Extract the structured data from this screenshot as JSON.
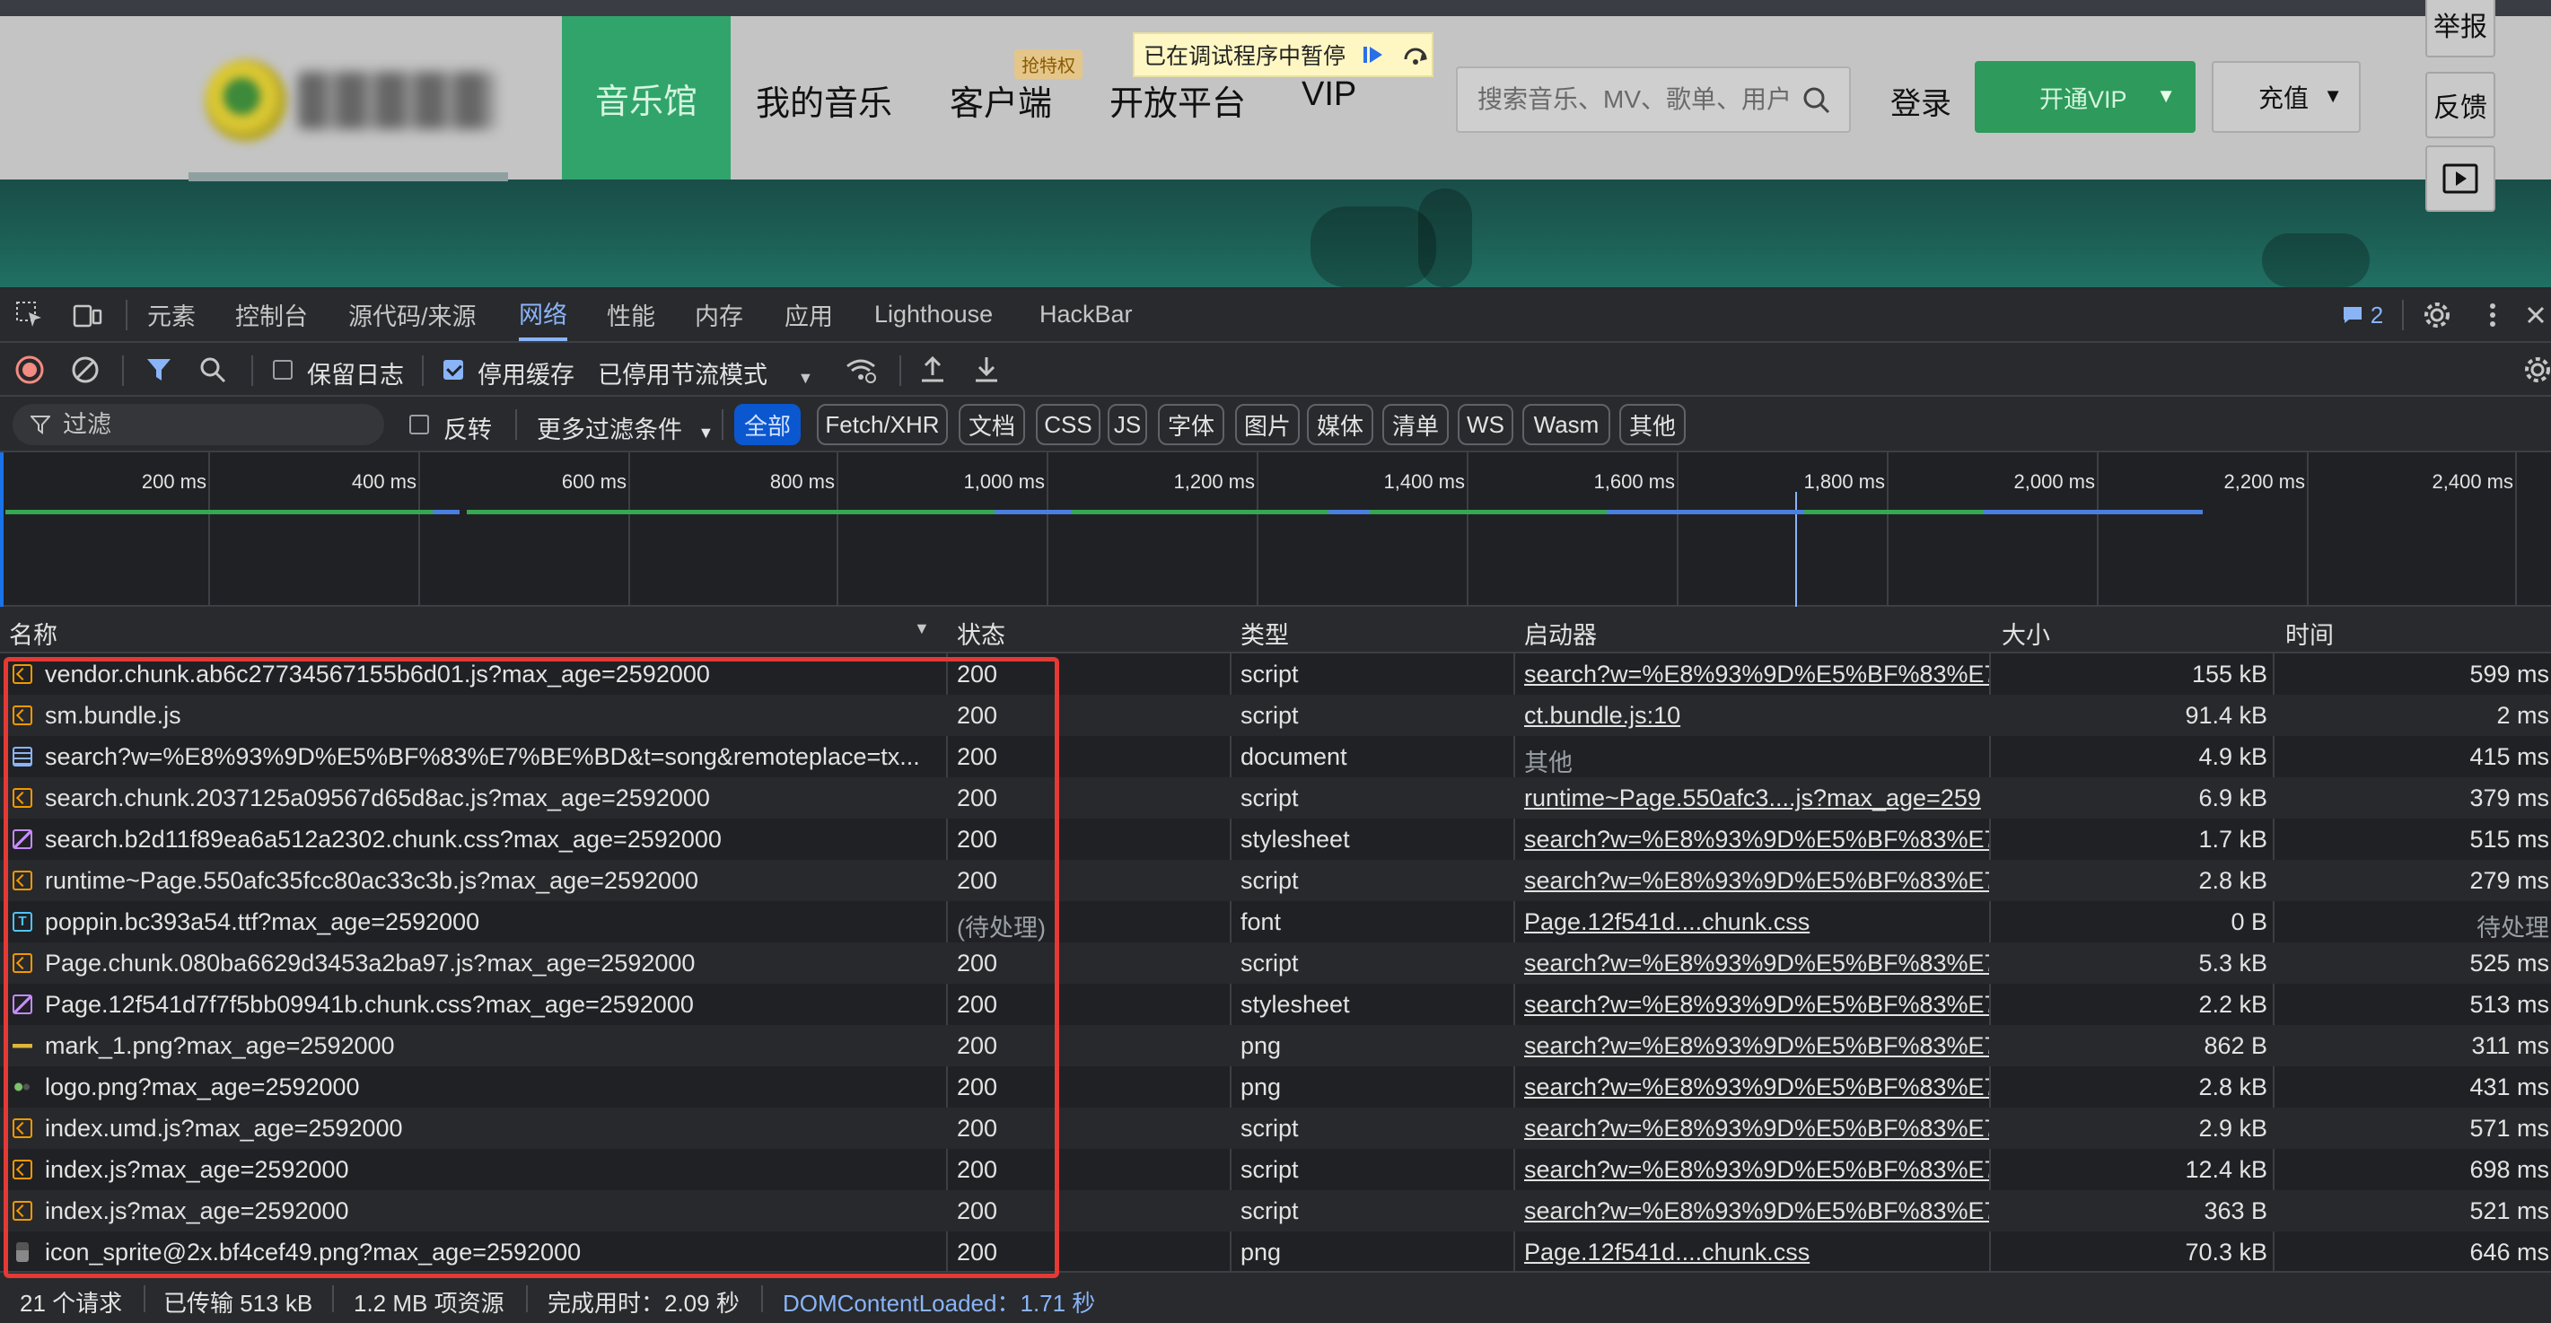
{
  "website": {
    "nav": {
      "music_hall": "音乐馆",
      "my_music": "我的音乐",
      "client": "客户端",
      "client_badge": "抢特权",
      "open_platform": "开放平台",
      "vip": "VIP"
    },
    "debugger_banner": "已在调试程序中暂停",
    "search_placeholder": "搜索音乐、MV、歌单、用户",
    "login": "登录",
    "vip_button": "开通VIP",
    "recharge_button": "充值",
    "side": {
      "report": "举报",
      "feedback": "反馈"
    }
  },
  "devtools": {
    "tabs": [
      "元素",
      "控制台",
      "源代码/来源",
      "网络",
      "性能",
      "内存",
      "应用",
      "Lighthouse",
      "HackBar"
    ],
    "active_tab": "网络",
    "issues_count": "2",
    "toolbar": {
      "preserve_log": "保留日志",
      "disable_cache": "停用缓存",
      "throttling": "已停用节流模式"
    },
    "filter": {
      "placeholder": "过滤",
      "invert": "反转",
      "more_filters": "更多过滤条件",
      "chips": [
        "全部",
        "Fetch/XHR",
        "文档",
        "CSS",
        "JS",
        "字体",
        "图片",
        "媒体",
        "清单",
        "WS",
        "Wasm",
        "其他"
      ]
    },
    "overview_ticks": [
      "200 ms",
      "400 ms",
      "600 ms",
      "800 ms",
      "1,000 ms",
      "1,200 ms",
      "1,400 ms",
      "1,600 ms",
      "1,800 ms",
      "2,000 ms",
      "2,200 ms",
      "2,400 ms"
    ],
    "columns": {
      "name": "名称",
      "status": "状态",
      "type": "类型",
      "initiator": "启动器",
      "size": "大小",
      "time": "时间"
    },
    "rows": [
      {
        "icon": "script",
        "name": "vendor.chunk.ab6c27734567155b6d01.js?max_age=2592000",
        "status": "200",
        "type": "script",
        "initiator": "search?w=%E8%93%9D%E5%BF%83%E7",
        "size": "155 kB",
        "time": "599 ms"
      },
      {
        "icon": "script",
        "name": "sm.bundle.js",
        "status": "200",
        "type": "script",
        "initiator": "ct.bundle.js:10",
        "size": "91.4 kB",
        "time": "2 ms"
      },
      {
        "icon": "document",
        "name": "search?w=%E8%93%9D%E5%BF%83%E7%BE%BD&t=song&remoteplace=tx...",
        "status": "200",
        "type": "document",
        "initiator": "其他",
        "size": "4.9 kB",
        "time": "415 ms"
      },
      {
        "icon": "script",
        "name": "search.chunk.2037125a09567d65d8ac.js?max_age=2592000",
        "status": "200",
        "type": "script",
        "initiator": "runtime~Page.550afc3....js?max_age=259",
        "size": "6.9 kB",
        "time": "379 ms"
      },
      {
        "icon": "stylesheet",
        "name": "search.b2d11f89ea6a512a2302.chunk.css?max_age=2592000",
        "status": "200",
        "type": "stylesheet",
        "initiator": "search?w=%E8%93%9D%E5%BF%83%E7",
        "size": "1.7 kB",
        "time": "515 ms"
      },
      {
        "icon": "script",
        "name": "runtime~Page.550afc35fcc80ac33c3b.js?max_age=2592000",
        "status": "200",
        "type": "script",
        "initiator": "search?w=%E8%93%9D%E5%BF%83%E7",
        "size": "2.8 kB",
        "time": "279 ms"
      },
      {
        "icon": "font",
        "name": "poppin.bc393a54.ttf?max_age=2592000",
        "status": "(待处理)",
        "type": "font",
        "initiator": "Page.12f541d....chunk.css",
        "size": "0 B",
        "time": "待处理"
      },
      {
        "icon": "script",
        "name": "Page.chunk.080ba6629d3453a2ba97.js?max_age=2592000",
        "status": "200",
        "type": "script",
        "initiator": "search?w=%E8%93%9D%E5%BF%83%E7",
        "size": "5.3 kB",
        "time": "525 ms"
      },
      {
        "icon": "stylesheet",
        "name": "Page.12f541d7f7f5bb09941b.chunk.css?max_age=2592000",
        "status": "200",
        "type": "stylesheet",
        "initiator": "search?w=%E8%93%9D%E5%BF%83%E7",
        "size": "2.2 kB",
        "time": "513 ms"
      },
      {
        "icon": "png-mark",
        "name": "mark_1.png?max_age=2592000",
        "status": "200",
        "type": "png",
        "initiator": "search?w=%E8%93%9D%E5%BF%83%E7",
        "size": "862 B",
        "time": "311 ms"
      },
      {
        "icon": "png-logo",
        "name": "logo.png?max_age=2592000",
        "status": "200",
        "type": "png",
        "initiator": "search?w=%E8%93%9D%E5%BF%83%E7",
        "size": "2.8 kB",
        "time": "431 ms"
      },
      {
        "icon": "script",
        "name": "index.umd.js?max_age=2592000",
        "status": "200",
        "type": "script",
        "initiator": "search?w=%E8%93%9D%E5%BF%83%E7",
        "size": "2.9 kB",
        "time": "571 ms"
      },
      {
        "icon": "script",
        "name": "index.js?max_age=2592000",
        "status": "200",
        "type": "script",
        "initiator": "search?w=%E8%93%9D%E5%BF%83%E7",
        "size": "12.4 kB",
        "time": "698 ms"
      },
      {
        "icon": "script",
        "name": "index.js?max_age=2592000",
        "status": "200",
        "type": "script",
        "initiator": "search?w=%E8%93%9D%E5%BF%83%E7",
        "size": "363 B",
        "time": "521 ms"
      },
      {
        "icon": "png-sprite",
        "name": "icon_sprite@2x.bf4cef49.png?max_age=2592000",
        "status": "200",
        "type": "png",
        "initiator": "Page.12f541d....chunk.css",
        "size": "70.3 kB",
        "time": "646 ms"
      }
    ],
    "status_bar": {
      "requests": "21 个请求",
      "transferred": "已传输 513 kB",
      "resources": "1.2 MB 项资源",
      "finish": "完成用时：2.09 秒",
      "dom_content_loaded": "DOMContentLoaded：1.71 秒"
    },
    "colors": {
      "accent": "#8ab4f8",
      "highlight_box": "#e53935",
      "site_green": "#31a46b"
    }
  }
}
